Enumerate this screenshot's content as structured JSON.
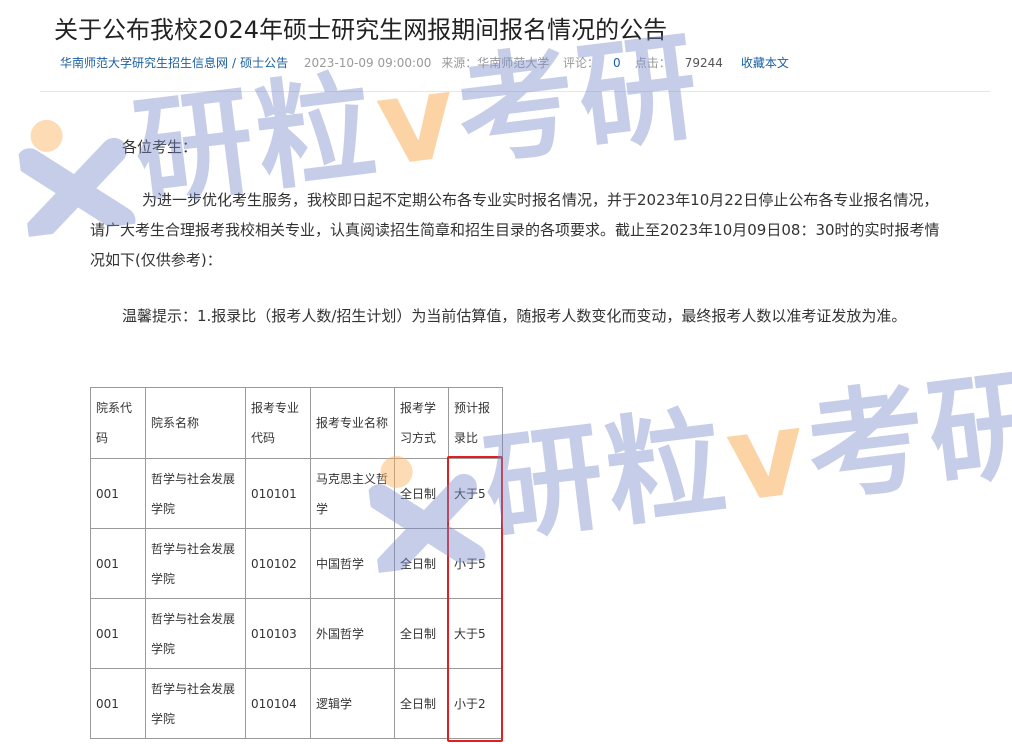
{
  "article": {
    "title": "关于公布我校2024年硕士研究生网报期间报名情况的公告",
    "meta": {
      "site_link": "华南师范大学研究生招生信息网",
      "separator": "/",
      "category_link": "硕士公告",
      "datetime": "2023-10-09 09:00:00",
      "source_label": "来源：华南师范大学",
      "comments_label": "评论：",
      "comments_count": "0",
      "clicks_label": "点击：",
      "clicks_count": "79244",
      "favorite_link": "收藏本文"
    },
    "greeting": "各位考生：",
    "paragraph1": "为进一步优化考生服务，我校即日起不定期公布各专业实时报名情况，并于2023年10月22日停止公布各专业报名情况，请广大考生合理报考我校相关专业，认真阅读招生简章和招生目录的各项要求。截止至2023年10月09日08：30时的实时报考情况如下(仅供参考)：",
    "paragraph2": "温馨提示：1.报录比（报考人数/招生计划）为当前估算值，随报考人数变化而变动，最终报考人数以准考证发放为准。"
  },
  "table": {
    "headers": [
      "院系代码",
      "院系名称",
      "报考专业代码",
      "报考专业名称",
      "报考学习方式",
      "预计报录比"
    ],
    "rows": [
      [
        "001",
        "哲学与社会发展学院",
        "010101",
        "马克思主义哲学",
        "全日制",
        "大于5"
      ],
      [
        "001",
        "哲学与社会发展学院",
        "010102",
        "中国哲学",
        "全日制",
        "小于5"
      ],
      [
        "001",
        "哲学与社会发展学院",
        "010103",
        "外国哲学",
        "全日制",
        "大于5"
      ],
      [
        "001",
        "哲学与社会发展学院",
        "010104",
        "逻辑学",
        "全日制",
        "小于2"
      ]
    ]
  },
  "watermark": {
    "text_a": "研粒",
    "text_v": "v",
    "text_b": "考研"
  },
  "colors": {
    "link": "#1a5fa3",
    "highlight": "#e02020",
    "watermark_blue": "#7887c8",
    "watermark_orange": "#faaf5a"
  }
}
